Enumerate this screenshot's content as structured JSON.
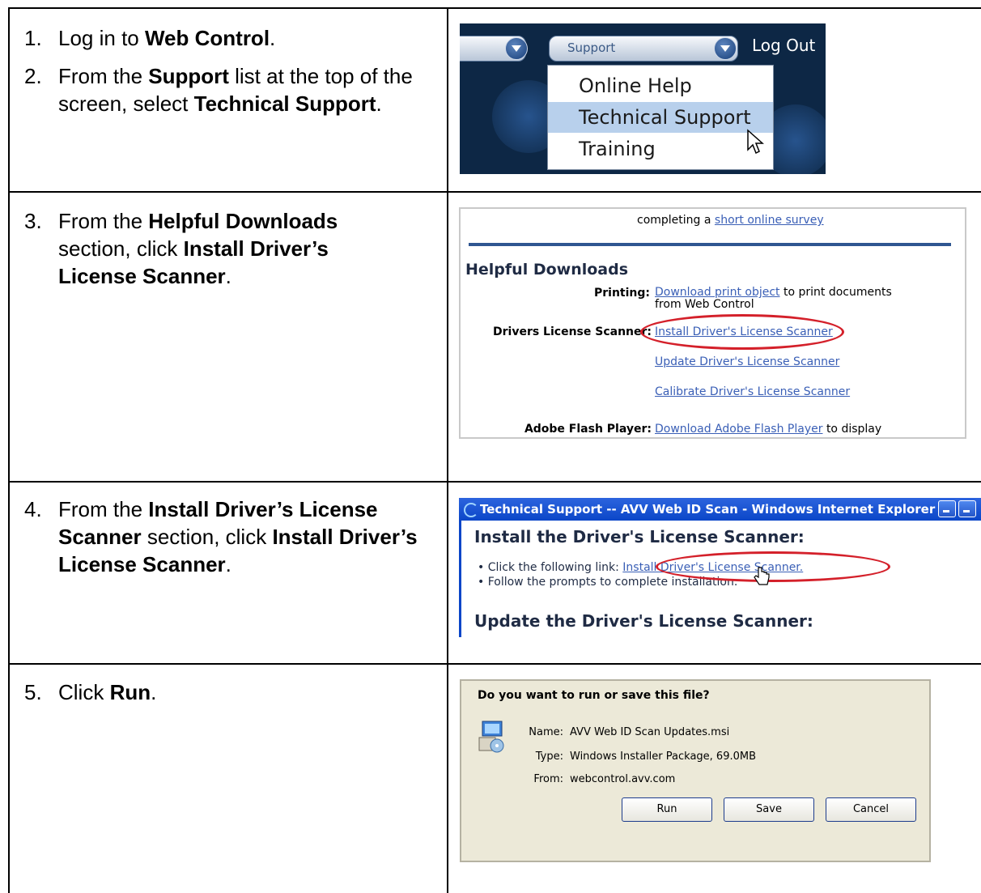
{
  "steps": [
    {
      "num": "1.",
      "parts": [
        "Log in to ",
        "Web Control",
        "."
      ]
    },
    {
      "num": "2.",
      "parts": [
        "From the ",
        "Support",
        " list at the top of the screen, select ",
        "Technical Support",
        "."
      ]
    },
    {
      "num": "3.",
      "parts": [
        "From the ",
        "Helpful Downloads",
        " section, click ",
        "Install Driver’s License Scanner",
        "."
      ]
    },
    {
      "num": "4.",
      "parts": [
        "From the ",
        "Install Driver’s License Scanner",
        " section, click ",
        "Install Driver’s License Scanner",
        "."
      ]
    },
    {
      "num": "5.",
      "parts": [
        "Click ",
        "Run",
        "."
      ]
    }
  ],
  "shot1": {
    "dropdown_label": "Support",
    "logout": "Log Out",
    "menu_items": [
      "Online Help",
      "Technical Support",
      "Training"
    ],
    "highlighted_item": "Technical Support"
  },
  "shot2": {
    "top_text": "completing a",
    "top_link": "short online survey",
    "heading": "Helpful Downloads",
    "printing_label": "Printing:",
    "printing_link": "Download print object",
    "printing_text_1": "to print documents",
    "printing_text_2": "from Web Control",
    "dls_label": "Drivers License Scanner:",
    "dls_install": "Install Driver's License Scanner",
    "dls_update": "Update Driver's License Scanner",
    "dls_calibrate": "Calibrate Driver's License Scanner",
    "flash_label": "Adobe Flash Player:",
    "flash_link": "Download Adobe Flash Player",
    "flash_text": "to display"
  },
  "shot3": {
    "window_title": "Technical Support -- AVV Web ID Scan - Windows Internet Explorer",
    "heading1": "Install the Driver's License Scanner:",
    "bullet1_text": "Click the following link:",
    "bullet1_link": "Install Driver's License Scanner.",
    "bullet2_text": "Follow the prompts to complete installation.",
    "heading2": "Update the Driver's License Scanner:"
  },
  "shot4": {
    "question": "Do you want to run or save this file?",
    "name_label": "Name:",
    "name_value": "AVV Web ID Scan Updates.msi",
    "type_label": "Type:",
    "type_value": "Windows Installer Package, 69.0MB",
    "from_label": "From:",
    "from_value": "webcontrol.avv.com",
    "run_button": "Run",
    "save_button": "Save",
    "cancel_button": "Cancel"
  },
  "colors": {
    "link": "#3a5fb6",
    "highlight_oval": "#d4202a",
    "menu_highlight": "#b8d0ec",
    "ie_titlebar": "#0b46c8",
    "dialog_bg": "#ece9d8"
  }
}
